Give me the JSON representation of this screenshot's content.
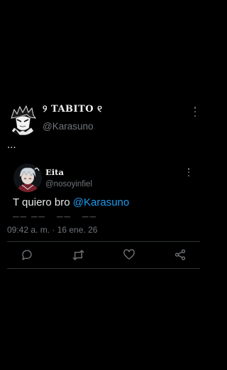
{
  "tweet": {
    "author": {
      "display_name": "୨ TABITO ୧",
      "handle": "@Karasuno",
      "avatar": "anime-avatar"
    },
    "more_icon": "more-vertical-icon",
    "text": "..."
  },
  "quote": {
    "author": {
      "display_name": "Eita",
      "handle": "@nosoyinfiel",
      "avatar": "anime-avatar"
    },
    "more_icon": "more-vertical-icon",
    "text": "T quiero bro ",
    "mention": "@Karasuno"
  },
  "timestamp": "09:42 a. m. · 16 ene. 26",
  "actions": [
    {
      "icon": "reply-icon"
    },
    {
      "icon": "retweet-icon"
    },
    {
      "icon": "like-icon"
    },
    {
      "icon": "share-icon"
    }
  ],
  "colors": {
    "background": "#000000",
    "text": "#e7e9ea",
    "muted": "#71767b",
    "mention": "#1d9bf0",
    "divider": "#2f3336"
  }
}
